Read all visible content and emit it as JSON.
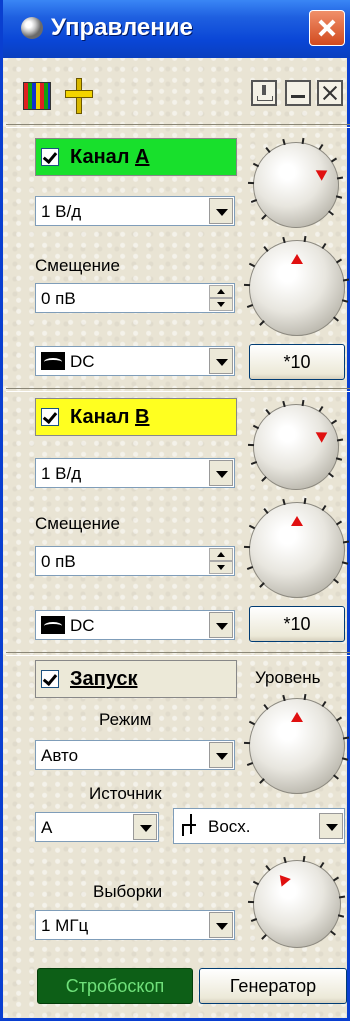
{
  "window": {
    "title": "Управление"
  },
  "channel_a": {
    "label": "Канал A",
    "label_main": "Канал ",
    "label_hot": "A",
    "color": "#18e02c",
    "volts_per_div": "1 В/д",
    "offset_label": "Смещение",
    "offset_value": "0 пВ",
    "coupling": "DC",
    "x10_label": "*10"
  },
  "channel_b": {
    "label": "Канал B",
    "label_main": "Канал ",
    "label_hot": "B",
    "color": "#ffff20",
    "volts_per_div": "1 В/д",
    "offset_label": "Смещение",
    "offset_value": "0 пВ",
    "coupling": "DC",
    "x10_label": "*10"
  },
  "trigger": {
    "enable_label": "Запуск",
    "level_label": "Уровень",
    "mode_label": "Режим",
    "mode_value": "Авто",
    "source_label": "Источник",
    "source_value": "A",
    "edge_value": "Восх."
  },
  "sampling": {
    "label": "Выборки",
    "rate_value": "1 МГц"
  },
  "buttons": {
    "strobe": "Стробоскоп",
    "generator": "Генератор"
  }
}
